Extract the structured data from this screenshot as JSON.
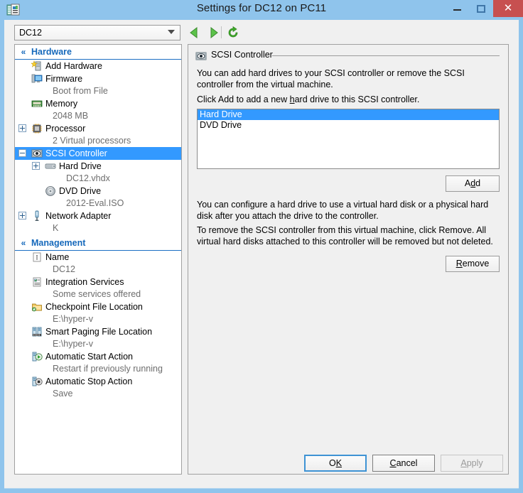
{
  "window": {
    "title": "Settings for DC12 on PC11",
    "icon": "settings-document-icon",
    "minimize_label": "–",
    "maximize_label": "□",
    "close_label": "✕",
    "frame_color": "#8fc4ec",
    "close_color": "#c75050"
  },
  "toolbar": {
    "vm_selector_value": "DC12",
    "back_icon": "back-arrow-icon",
    "forward_icon": "forward-arrow-icon",
    "refresh_icon": "refresh-icon"
  },
  "sidebar": {
    "groups": [
      {
        "label": "Hardware",
        "chevron": "«",
        "items": [
          {
            "label": "Add Hardware",
            "icon": "add-hardware-icon",
            "sub": null,
            "expander": null,
            "level": 1,
            "selected": false
          },
          {
            "label": "Firmware",
            "icon": "firmware-icon",
            "sub": "Boot from File",
            "expander": null,
            "level": 1,
            "selected": false
          },
          {
            "label": "Memory",
            "icon": "memory-icon",
            "sub": "2048 MB",
            "expander": null,
            "level": 1,
            "selected": false
          },
          {
            "label": "Processor",
            "icon": "processor-icon",
            "sub": "2 Virtual processors",
            "expander": "plus",
            "level": 1,
            "selected": false
          },
          {
            "label": "SCSI Controller",
            "icon": "scsi-controller-icon",
            "sub": null,
            "expander": "minus",
            "level": 1,
            "selected": true
          },
          {
            "label": "Hard Drive",
            "icon": "hard-drive-icon",
            "sub": "DC12.vhdx",
            "expander": "plus",
            "level": 2,
            "selected": false
          },
          {
            "label": "DVD Drive",
            "icon": "dvd-drive-icon",
            "sub": "2012-Eval.ISO",
            "expander": null,
            "level": 2,
            "selected": false
          },
          {
            "label": "Network Adapter",
            "icon": "network-adapter-icon",
            "sub": "K",
            "expander": "plus",
            "level": 1,
            "selected": false
          }
        ]
      },
      {
        "label": "Management",
        "chevron": "«",
        "items": [
          {
            "label": "Name",
            "icon": "name-icon",
            "sub": "DC12",
            "expander": null,
            "level": 1,
            "selected": false
          },
          {
            "label": "Integration Services",
            "icon": "integration-services-icon",
            "sub": "Some services offered",
            "expander": null,
            "level": 1,
            "selected": false
          },
          {
            "label": "Checkpoint File Location",
            "icon": "checkpoint-folder-icon",
            "sub": "E:\\hyper-v",
            "expander": null,
            "level": 1,
            "selected": false
          },
          {
            "label": "Smart Paging File Location",
            "icon": "smart-paging-icon",
            "sub": "E:\\hyper-v",
            "expander": null,
            "level": 1,
            "selected": false
          },
          {
            "label": "Automatic Start Action",
            "icon": "auto-start-icon",
            "sub": "Restart if previously running",
            "expander": null,
            "level": 1,
            "selected": false
          },
          {
            "label": "Automatic Stop Action",
            "icon": "auto-stop-icon",
            "sub": "Save",
            "expander": null,
            "level": 1,
            "selected": false
          }
        ]
      }
    ]
  },
  "main": {
    "group_title": "SCSI Controller",
    "group_icon": "scsi-controller-icon",
    "paragraph1": "You can add hard drives to your SCSI controller or remove the SCSI controller from the virtual machine.",
    "paragraph2_pre": "Click Add to add a new ",
    "paragraph2_accel": "h",
    "paragraph2_post": "ard drive to this SCSI controller.",
    "list_items": [
      {
        "label": "Hard Drive",
        "selected": true
      },
      {
        "label": "DVD Drive",
        "selected": false
      }
    ],
    "add_button": {
      "pre": "A",
      "accel": "d",
      "post": "d"
    },
    "paragraph3": "You can configure a hard drive to use a virtual hard disk or a physical hard disk after you attach the drive to the controller.",
    "paragraph4": "To remove the SCSI controller from this virtual machine, click Remove. All virtual hard disks attached to this controller will be removed but not deleted.",
    "remove_button": {
      "pre": "",
      "accel": "R",
      "post": "emove"
    }
  },
  "footer": {
    "ok": {
      "pre": "O",
      "accel": "K",
      "post": ""
    },
    "cancel": {
      "pre": "",
      "accel": "C",
      "post": "ancel"
    },
    "apply": {
      "pre": "",
      "accel": "A",
      "post": "pply"
    },
    "apply_enabled": false
  },
  "colors": {
    "selection_blue": "#3399ff",
    "group_header_blue": "#1669bb",
    "dialog_bg": "#f0f0f0"
  }
}
